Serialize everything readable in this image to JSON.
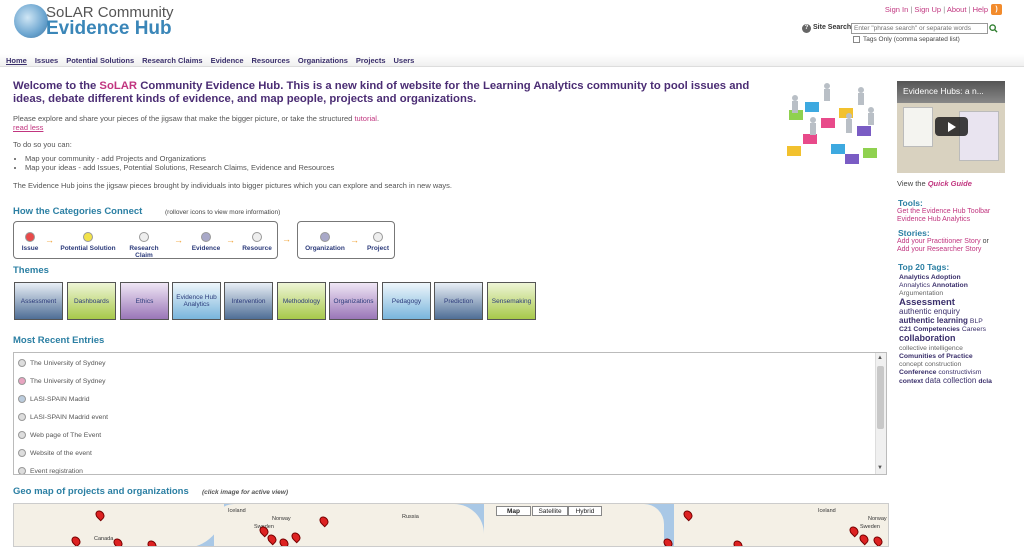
{
  "header": {
    "logo_line1": "SoLAR Community",
    "logo_line2": "Evidence Hub",
    "top_links": [
      "Sign In",
      "Sign Up",
      "About",
      "Help"
    ],
    "search_label": "Site Search",
    "search_placeholder": "Enter \"phrase search\" or separate words",
    "tags_only_label": "Tags Only (comma separated list)"
  },
  "nav": {
    "items": [
      "Home",
      "Issues",
      "Potential Solutions",
      "Research Claims",
      "Evidence",
      "Resources",
      "Organizations",
      "Projects",
      "Users"
    ]
  },
  "welcome": {
    "title_prefix": "Welcome to the ",
    "title_highlight": "SoLAR",
    "title_suffix": " Community Evidence Hub. This is a new kind of website for the Learning Analytics community to pool issues and ideas, debate different kinds of evidence, and map people, projects and organizations.",
    "intro_prefix": "Please explore and share your pieces of the jigsaw that make the bigger picture, or take the structured ",
    "intro_link": "tutorial",
    "intro_suffix": ".",
    "read_less": "read less",
    "todo_intro": "To do so you can:",
    "todo_items": [
      "Map your community - add Projects and Organizations",
      "Map your ideas - add Issues, Potential Solutions, Research Claims, Evidence and Resources"
    ],
    "join_text": "The Evidence Hub joins the jigsaw pieces brought by individuals into bigger pictures which you can explore and search in new ways."
  },
  "categories": {
    "title": "How the Categories Connect",
    "hint": "(rollover icons to view more information)",
    "items": [
      "Issue",
      "Potential Solution",
      "Research Claim",
      "Evidence",
      "Resource",
      "Organization",
      "Project"
    ]
  },
  "themes": {
    "title": "Themes",
    "items": [
      "Assessment",
      "Dashboards",
      "Ethics",
      "Evidence Hub Analytics",
      "Intervention",
      "Methodology",
      "Organizations",
      "Pedagogy",
      "Prediction",
      "Sensemaking"
    ]
  },
  "recent": {
    "title": "Most Recent Entries",
    "items": [
      "The University of Sydney",
      "The University of Sydney",
      "LASI-SPAIN Madrid",
      "LASI-SPAIN Madrid event",
      "Web page of The Event",
      "Website of the event",
      "Event registration"
    ]
  },
  "geo": {
    "title": "Geo map of projects and organizations",
    "hint": "(click image for active view)",
    "map_types": [
      "Map",
      "Satellite",
      "Hybrid"
    ],
    "labels": [
      "Iceland",
      "Norway",
      "Russia",
      "Canada",
      "Sweden",
      "Iceland",
      "Norway",
      "Sweden"
    ]
  },
  "sidebar": {
    "video_title": "Evidence Hubs: a n...",
    "quick_prefix": "View the ",
    "quick_link": "Quick Guide",
    "tools_title": "Tools:",
    "tools_links": [
      "Get the Evidence Hub Toolbar",
      "Evidence Hub Analytics"
    ],
    "stories_title": "Stories:",
    "stories_line1": "Add your Practitioner Story",
    "stories_or": " or",
    "stories_line2": "Add your Researcher Story",
    "tags_title": "Top 20 Tags:",
    "tags": [
      "Analytics Adoption",
      "Annalytics",
      "Annotation",
      "Argumentation",
      "Assessment",
      "authentic enquiry",
      "authentic learning",
      "BLP",
      "C21 Competencies",
      "Careers",
      "collaboration",
      "collective intelligence",
      "Comunities of Practice",
      "concept construction",
      "Conference",
      "constructivism",
      "context",
      "data collection",
      "dcla"
    ]
  },
  "colors": {
    "accent_pink": "#c1357f",
    "title_purple": "#4b2d74",
    "section_blue": "#2b7fa3",
    "rss_orange": "#f28b2c"
  }
}
